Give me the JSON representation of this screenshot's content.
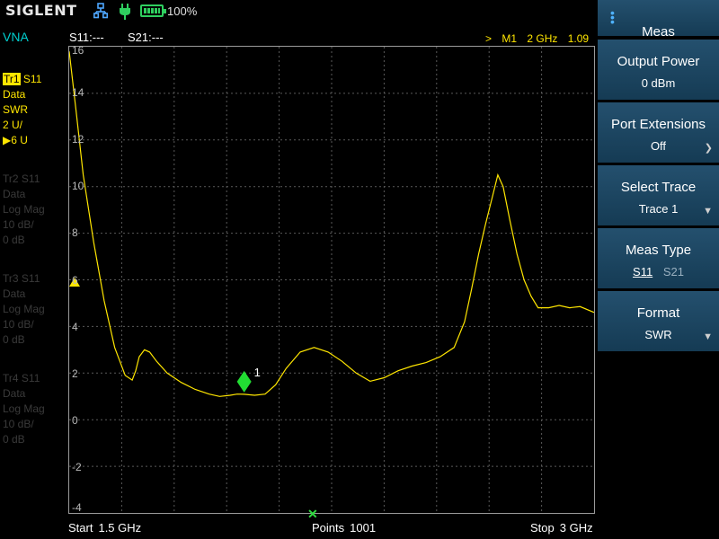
{
  "status_bar": {
    "logo": "SIGLENT",
    "battery_percent": "100%",
    "icons": [
      "network-icon",
      "power-plug-icon",
      "battery-icon"
    ]
  },
  "mode_label": "VNA",
  "traces": [
    {
      "id": "Tr1",
      "param": "S11",
      "format": "Data",
      "scale_type": "SWR",
      "scale": "2 U/",
      "ref": "▶6 U",
      "active": true
    },
    {
      "id": "Tr2",
      "param": "S11",
      "format": "Data",
      "scale_type": "Log Mag",
      "scale": "10 dB/",
      "ref": "0 dB",
      "active": false
    },
    {
      "id": "Tr3",
      "param": "S11",
      "format": "Data",
      "scale_type": "Log Mag",
      "scale": "10 dB/",
      "ref": "0 dB",
      "active": false
    },
    {
      "id": "Tr4",
      "param": "S11",
      "format": "Data",
      "scale_type": "Log Mag",
      "scale": "10 dB/",
      "ref": "0 dB",
      "active": false
    }
  ],
  "readouts": {
    "s11": "S11:---",
    "s21": "S21:---",
    "marker_prefix": ">",
    "marker_name": "M1",
    "marker_freq": "2 GHz",
    "marker_value": "1.09"
  },
  "plot": {
    "y_ticks": [
      "16",
      "14",
      "12",
      "10",
      "8",
      "6",
      "4",
      "2",
      "0",
      "-2",
      "-4"
    ],
    "marker_label": "1"
  },
  "footer": {
    "start_label": "Start",
    "start_value": "1.5 GHz",
    "points_label": "Points",
    "points_value": "1001",
    "stop_label": "Stop",
    "stop_value": "3 GHz"
  },
  "chart_data": {
    "type": "line",
    "xlabel": "",
    "ylabel": "",
    "xlim": [
      1.5,
      3.0
    ],
    "ylim": [
      -4,
      16
    ],
    "grid": true,
    "series": [
      {
        "color": "#ffe600",
        "x": [
          1.5,
          1.52,
          1.54,
          1.57,
          1.6,
          1.63,
          1.66,
          1.68,
          1.69,
          1.7,
          1.715,
          1.73,
          1.75,
          1.78,
          1.82,
          1.86,
          1.9,
          1.93,
          1.96,
          1.98,
          2.0,
          2.03,
          2.06,
          2.09,
          2.12,
          2.16,
          2.2,
          2.24,
          2.28,
          2.32,
          2.36,
          2.4,
          2.44,
          2.48,
          2.52,
          2.56,
          2.6,
          2.63,
          2.65,
          2.67,
          2.69,
          2.71,
          2.725,
          2.74,
          2.76,
          2.78,
          2.8,
          2.82,
          2.84,
          2.87,
          2.9,
          2.93,
          2.96,
          3.0
        ],
        "y": [
          15.8,
          13.2,
          10.5,
          7.6,
          5.1,
          3.1,
          1.9,
          1.7,
          2.1,
          2.7,
          3.0,
          2.9,
          2.5,
          2.0,
          1.6,
          1.3,
          1.1,
          1.0,
          1.05,
          1.1,
          1.09,
          1.05,
          1.1,
          1.5,
          2.2,
          2.9,
          3.1,
          2.9,
          2.5,
          2.0,
          1.65,
          1.8,
          2.1,
          2.3,
          2.45,
          2.7,
          3.1,
          4.2,
          5.6,
          7.1,
          8.4,
          9.6,
          10.5,
          10.0,
          8.5,
          7.1,
          6.0,
          5.3,
          4.8,
          4.8,
          4.9,
          4.8,
          4.85,
          4.6
        ]
      }
    ],
    "marker": {
      "name": "M1",
      "x": 2.0,
      "y": 1.09
    },
    "reference_level": 6
  },
  "softkeys": {
    "header": "Meas",
    "output_power": {
      "title": "Output Power",
      "value": "0 dBm"
    },
    "port_extensions": {
      "title": "Port Extensions",
      "value": "Off"
    },
    "select_trace": {
      "title": "Select Trace",
      "value": "Trace 1"
    },
    "meas_type": {
      "title": "Meas Type",
      "option1": "S11",
      "option2": "S21"
    },
    "format": {
      "title": "Format",
      "value": "SWR"
    }
  }
}
